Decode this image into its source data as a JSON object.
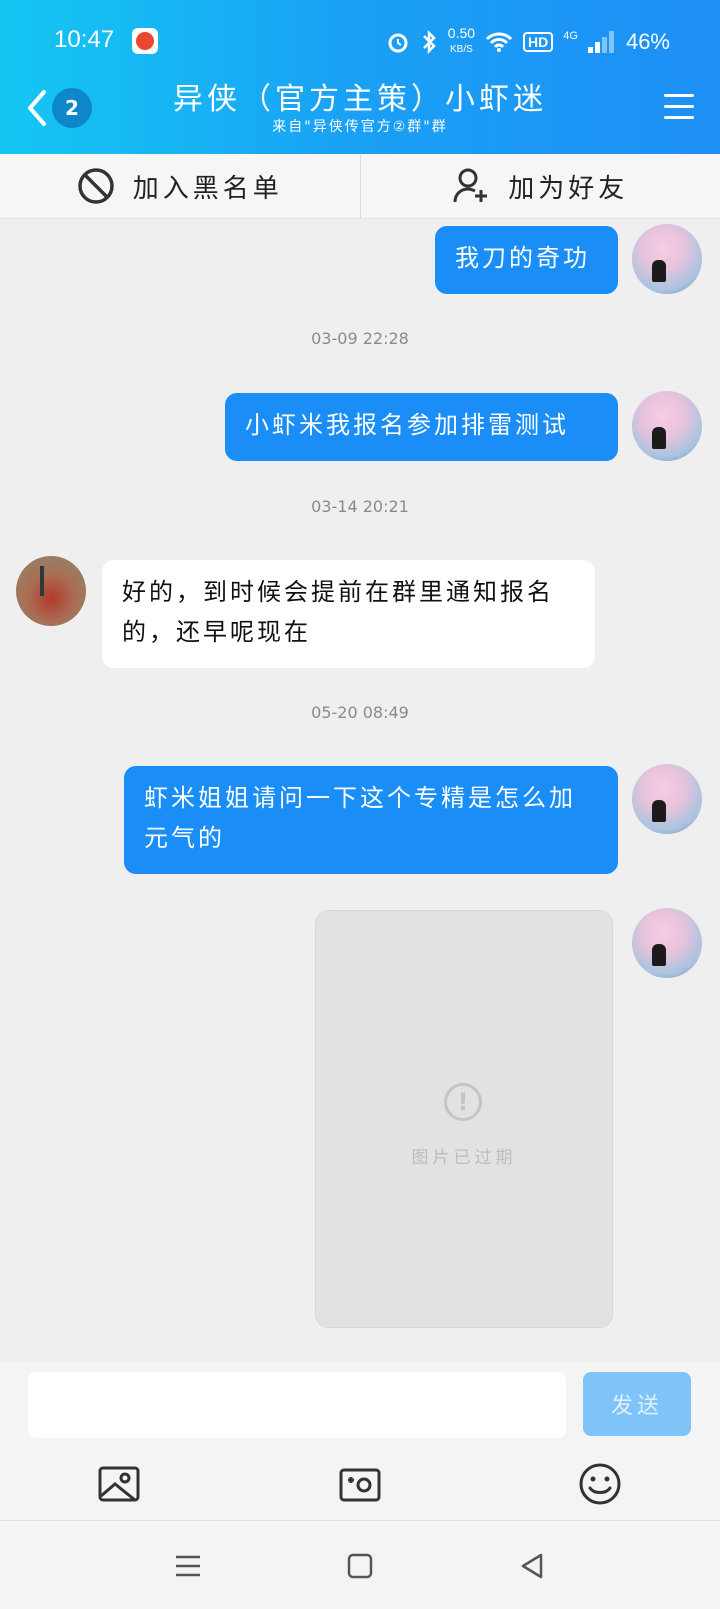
{
  "status_bar": {
    "time": "10:47",
    "net_speed_value": "0.50",
    "net_speed_unit": "KB/S",
    "network_type": "4G",
    "hd_label": "HD",
    "battery": "46%"
  },
  "header": {
    "badge_count": "2",
    "title": "异侠（官方主策）小虾迷",
    "subtitle": "来自\"异侠传官方②群\"群"
  },
  "actions": {
    "blacklist_label": "加入黑名单",
    "add_friend_label": "加为好友"
  },
  "messages": [
    {
      "side": "out",
      "text": "我刀的奇功"
    },
    {
      "type": "timestamp",
      "text": "03-09 22:28"
    },
    {
      "side": "out",
      "text": "小虾米我报名参加排雷测试"
    },
    {
      "type": "timestamp",
      "text": "03-14 20:21"
    },
    {
      "side": "in",
      "text": "好的，到时候会提前在群里通知报名的，还早呢现在"
    },
    {
      "type": "timestamp",
      "text": "05-20 08:49"
    },
    {
      "side": "out",
      "text": "虾米姐姐请问一下这个专精是怎么加元气的"
    },
    {
      "side": "out",
      "type": "image",
      "status_text": "图片已过期"
    }
  ],
  "input": {
    "value": "",
    "send_label": "发送"
  },
  "icons": {
    "back": "chevron-left-icon",
    "menu": "menu-icon",
    "blacklist": "block-icon",
    "add_friend": "add-user-icon",
    "gallery": "image-icon",
    "camera": "camera-icon",
    "emoji": "emoji-icon"
  },
  "colors": {
    "header_start": "#14c7f3",
    "header_end": "#1d8ff6",
    "bubble_out": "#1a8ef6",
    "bubble_in": "#ffffff",
    "send_disabled": "#7ec4f8"
  }
}
